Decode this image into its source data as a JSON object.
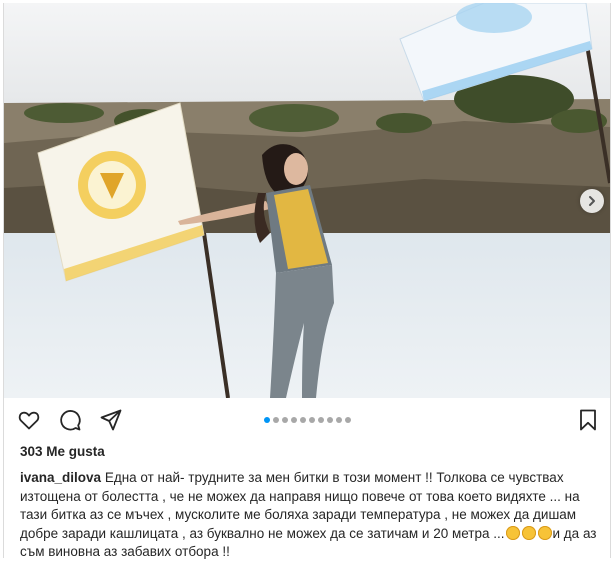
{
  "post": {
    "username": "ivana_dilova",
    "likes": "303 Me gusta",
    "caption_text_1": "Една от най- трудните за мен битки в този момент !! Толкова се чувствах изтощена от болестта , че не можех да направя нищо повече от това което видяхте ... на тази битка аз се мъчех , мусколите ме боляха заради температура , не можех да дишам добре заради кашлицата , аз буквално не можех да се затичам и 20 метра ...",
    "caption_text_2": "и да аз съм виновна аз забавих отбора !!",
    "caption_emojis": [
      "sweat-smile-emoji",
      "worried-face-emoji",
      "worried-face-emoji"
    ],
    "carousel": {
      "total": 10,
      "active_index": 0
    }
  },
  "icons": {
    "like": "heart-icon",
    "comment": "comment-icon",
    "share": "paper-plane-icon",
    "save": "bookmark-icon",
    "next": "chevron-right-icon"
  },
  "colors": {
    "carousel_active": "#0095f6",
    "carousel_inactive": "#a8a8a8",
    "text": "#262626"
  }
}
